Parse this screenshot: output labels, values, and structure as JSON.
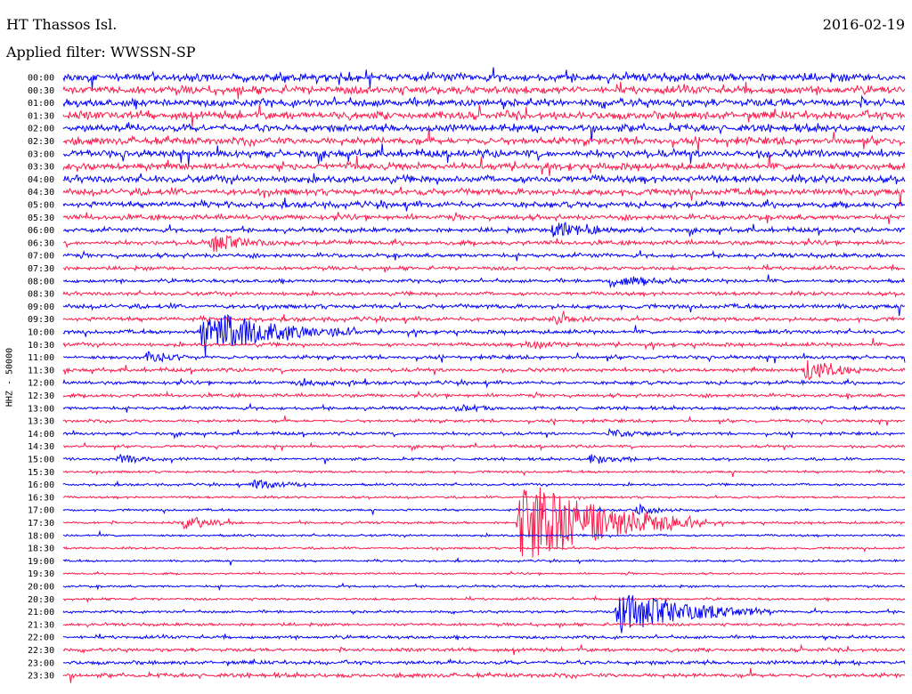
{
  "header": {
    "station": "HT Thassos Isl.",
    "date": "2016-02-19",
    "filter": "Applied filter: WWSSN-SP"
  },
  "channel_label": "HHZ - 50000",
  "colors": {
    "even_trace": "#0000ff",
    "odd_trace": "#ff1a4a",
    "text": "#000000",
    "background": "#ffffff"
  },
  "chart_data": {
    "type": "line",
    "title": "HT Thassos Isl.",
    "subtitle": "Applied filter: WWSSN-SP",
    "ylabel": "HHZ - 50000",
    "xlabel": "",
    "rows_per_hour": 2,
    "row_minutes": 30,
    "rows": [
      {
        "time": "00:00",
        "noise": 5.5,
        "events": []
      },
      {
        "time": "00:30",
        "noise": 5.5,
        "events": []
      },
      {
        "time": "01:00",
        "noise": 5.5,
        "events": []
      },
      {
        "time": "01:30",
        "noise": 5.5,
        "events": []
      },
      {
        "time": "02:00",
        "noise": 5.0,
        "events": []
      },
      {
        "time": "02:30",
        "noise": 5.0,
        "events": []
      },
      {
        "time": "03:00",
        "noise": 5.0,
        "events": []
      },
      {
        "time": "03:30",
        "noise": 4.8,
        "events": []
      },
      {
        "time": "04:00",
        "noise": 4.8,
        "events": []
      },
      {
        "time": "04:30",
        "noise": 4.5,
        "events": []
      },
      {
        "time": "05:00",
        "noise": 4.0,
        "events": []
      },
      {
        "time": "05:30",
        "noise": 3.5,
        "events": []
      },
      {
        "time": "06:00",
        "noise": 3.0,
        "events": [
          {
            "minute": 17.5,
            "amp": 10,
            "dur": 1.5
          }
        ]
      },
      {
        "time": "06:30",
        "noise": 3.0,
        "events": [
          {
            "minute": 5.3,
            "amp": 12,
            "dur": 1.2
          }
        ]
      },
      {
        "time": "07:00",
        "noise": 2.8,
        "events": []
      },
      {
        "time": "07:30",
        "noise": 2.5,
        "events": []
      },
      {
        "time": "08:00",
        "noise": 2.5,
        "events": [
          {
            "minute": 19.5,
            "amp": 8,
            "dur": 1.5
          }
        ]
      },
      {
        "time": "08:30",
        "noise": 2.5,
        "events": []
      },
      {
        "time": "09:00",
        "noise": 3.0,
        "events": []
      },
      {
        "time": "09:30",
        "noise": 2.8,
        "events": [
          {
            "minute": 17.5,
            "amp": 6,
            "dur": 1.0
          }
        ]
      },
      {
        "time": "10:00",
        "noise": 2.6,
        "events": [
          {
            "minute": 5.0,
            "amp": 28,
            "dur": 2.5
          }
        ]
      },
      {
        "time": "10:30",
        "noise": 2.5,
        "events": [
          {
            "minute": 16.5,
            "amp": 6,
            "dur": 1.0
          }
        ]
      },
      {
        "time": "11:00",
        "noise": 2.5,
        "events": [
          {
            "minute": 3.0,
            "amp": 8,
            "dur": 1.0
          }
        ]
      },
      {
        "time": "11:30",
        "noise": 2.5,
        "events": [
          {
            "minute": 26.5,
            "amp": 14,
            "dur": 1.2
          }
        ]
      },
      {
        "time": "12:00",
        "noise": 2.4,
        "events": [
          {
            "minute": 8.5,
            "amp": 5,
            "dur": 1.0
          }
        ]
      },
      {
        "time": "12:30",
        "noise": 2.3,
        "events": []
      },
      {
        "time": "13:00",
        "noise": 2.2,
        "events": [
          {
            "minute": 14.0,
            "amp": 6,
            "dur": 1.2
          }
        ]
      },
      {
        "time": "13:30",
        "noise": 2.0,
        "events": []
      },
      {
        "time": "14:00",
        "noise": 2.0,
        "events": [
          {
            "minute": 19.5,
            "amp": 5,
            "dur": 1.0
          }
        ]
      },
      {
        "time": "14:30",
        "noise": 1.8,
        "events": []
      },
      {
        "time": "15:00",
        "noise": 1.8,
        "events": [
          {
            "minute": 2.0,
            "amp": 6,
            "dur": 1.0
          },
          {
            "minute": 18.8,
            "amp": 6,
            "dur": 1.2
          }
        ]
      },
      {
        "time": "15:30",
        "noise": 1.6,
        "events": []
      },
      {
        "time": "16:00",
        "noise": 1.6,
        "events": [
          {
            "minute": 6.8,
            "amp": 8,
            "dur": 1.0
          }
        ]
      },
      {
        "time": "16:30",
        "noise": 1.5,
        "events": []
      },
      {
        "time": "17:00",
        "noise": 1.5,
        "events": [
          {
            "minute": 20.5,
            "amp": 6,
            "dur": 0.8
          }
        ]
      },
      {
        "time": "17:30",
        "noise": 1.6,
        "events": [
          {
            "minute": 4.3,
            "amp": 9,
            "dur": 1.0
          },
          {
            "minute": 16.3,
            "amp": 50,
            "dur": 3.0
          }
        ]
      },
      {
        "time": "18:00",
        "noise": 1.5,
        "events": []
      },
      {
        "time": "18:30",
        "noise": 1.5,
        "events": []
      },
      {
        "time": "19:00",
        "noise": 1.4,
        "events": []
      },
      {
        "time": "19:30",
        "noise": 1.3,
        "events": []
      },
      {
        "time": "20:00",
        "noise": 1.5,
        "events": []
      },
      {
        "time": "20:30",
        "noise": 1.6,
        "events": []
      },
      {
        "time": "21:00",
        "noise": 1.8,
        "events": [
          {
            "minute": 19.8,
            "amp": 26,
            "dur": 2.5
          }
        ]
      },
      {
        "time": "21:30",
        "noise": 2.0,
        "events": []
      },
      {
        "time": "22:00",
        "noise": 2.2,
        "events": []
      },
      {
        "time": "22:30",
        "noise": 2.4,
        "events": []
      },
      {
        "time": "23:00",
        "noise": 2.6,
        "events": []
      },
      {
        "time": "23:30",
        "noise": 2.8,
        "events": []
      }
    ]
  }
}
